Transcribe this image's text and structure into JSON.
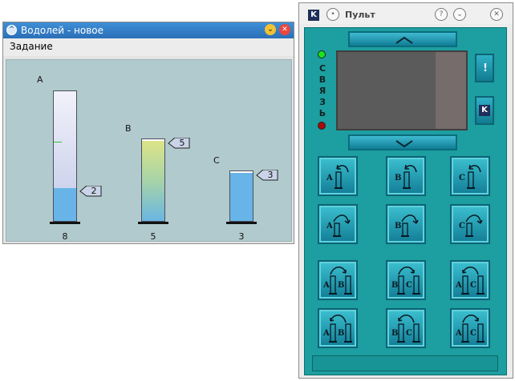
{
  "vodoley": {
    "title": "Водолей - новое",
    "menu_task": "Задание",
    "vessels": [
      {
        "letter": "A",
        "capacity": "8",
        "amount": "2",
        "fill_fraction": 0.25
      },
      {
        "letter": "B",
        "capacity": "5",
        "amount": "5",
        "fill_fraction": 1.0
      },
      {
        "letter": "C",
        "capacity": "3",
        "amount": "3",
        "fill_fraction": 1.0
      }
    ]
  },
  "pult": {
    "title": "Пульт",
    "logo": "K",
    "help_icon": "?",
    "vertical_label": [
      "С",
      "В",
      "Я",
      "З",
      "Ь"
    ],
    "side_button_top": "!",
    "side_button_bottom": "K",
    "led_top_color": "#19e619",
    "led_bottom_color": "#aa0a0a",
    "commands": [
      {
        "name": "fill",
        "labels": [
          "A"
        ]
      },
      {
        "name": "fill",
        "labels": [
          "B"
        ]
      },
      {
        "name": "fill",
        "labels": [
          "C"
        ]
      },
      {
        "name": "empty",
        "labels": [
          "A"
        ]
      },
      {
        "name": "empty",
        "labels": [
          "B"
        ]
      },
      {
        "name": "empty",
        "labels": [
          "C"
        ]
      },
      {
        "name": "pour-right",
        "labels": [
          "A",
          "B"
        ]
      },
      {
        "name": "pour-right",
        "labels": [
          "B",
          "C"
        ]
      },
      {
        "name": "pour-left",
        "labels": [
          "A",
          "C"
        ]
      },
      {
        "name": "pour-left",
        "labels": [
          "A",
          "B"
        ]
      },
      {
        "name": "pour-left",
        "labels": [
          "B",
          "C"
        ]
      },
      {
        "name": "pour-right",
        "labels": [
          "A",
          "C"
        ]
      }
    ]
  }
}
